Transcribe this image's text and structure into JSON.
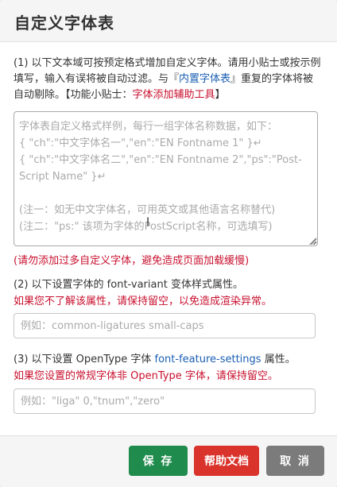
{
  "header": {
    "title": "自定义字体表"
  },
  "intro": {
    "part1": "(1) 以下文本域可按预定格式增加自定义字体。请用小贴士或按示例填写，输入有误将被自动过滤。与『",
    "link1": "内置字体表",
    "part2": "』重复的字体将被自动剔除。【功能小贴士：",
    "link2": "字体添加辅助工具",
    "part3": "】"
  },
  "font_table": {
    "placeholder": "字体表自定义格式样例，每行一组字体名称数据，如下：\n{ \"ch\":\"中文字体名一\",\"en\":\"EN Fontname 1\" }↵\n{ \"ch\":\"中文字体名二\",\"en\":\"EN Fontname 2\",\"ps\":\"Post-Script Name\" }↵\n\n(注一：如无中文字体名，可用英文或其他语言名称替代)\n(注二：\"ps:\" 该项为字体的PostScript名称，可选填写)"
  },
  "warning1": "(请勿添加过多自定义字体，避免造成页面加载缓慢)",
  "section2": {
    "text": "(2) 以下设置字体的 font-variant 变体样式属性。",
    "warning": "如果您不了解该属性，请保持留空，以免造成渲染异常。",
    "placeholder": "例如：common-ligatures small-caps"
  },
  "section3": {
    "text_pre": "(3) 以下设置 OpenType 字体 ",
    "link": "font-feature-settings",
    "text_post": " 属性。",
    "warning": "如果您设置的常规字体非 OpenType 字体，请保持留空。",
    "placeholder": "例如：\"liga\" 0,\"tnum\",\"zero\""
  },
  "footer": {
    "save_label": "保 存",
    "help_label": "帮助文档",
    "cancel_label": "取 消"
  },
  "colors": {
    "save": "#1f8b4c",
    "help": "#d9332b",
    "cancel": "#7b7b7b",
    "warning": "#c8102e",
    "link": "#1a5fb4"
  }
}
